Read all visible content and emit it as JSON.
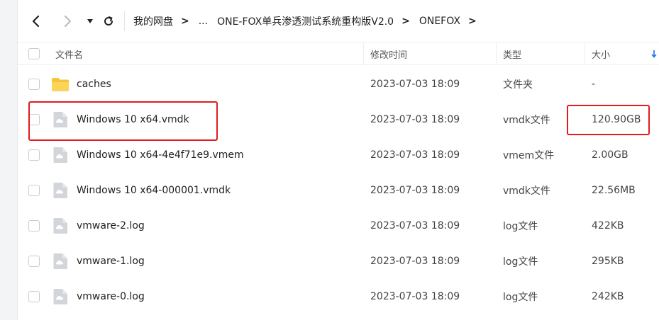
{
  "toolbar": {
    "breadcrumb": [
      "我的网盘",
      "...",
      "ONE-FOX单兵渗透测试系统重构版V2.0",
      "ONEFOX"
    ],
    "separator": ">"
  },
  "table": {
    "headers": {
      "name": "文件名",
      "modified": "修改时间",
      "type": "类型",
      "size": "大小"
    },
    "rows": [
      {
        "name": "caches",
        "modified": "2023-07-03 18:09",
        "type": "文件夹",
        "size": "-",
        "icon": "folder-icon"
      },
      {
        "name": "Windows 10 x64.vmdk",
        "modified": "2023-07-03 18:09",
        "type": "vmdk文件",
        "size": "120.90GB",
        "icon": "file-icon"
      },
      {
        "name": "Windows 10 x64-4e4f71e9.vmem",
        "modified": "2023-07-03 18:09",
        "type": "vmem文件",
        "size": "2.00GB",
        "icon": "file-icon"
      },
      {
        "name": "Windows 10 x64-000001.vmdk",
        "modified": "2023-07-03 18:09",
        "type": "vmdk文件",
        "size": "22.56MB",
        "icon": "file-icon"
      },
      {
        "name": "vmware-2.log",
        "modified": "2023-07-03 18:09",
        "type": "log文件",
        "size": "422KB",
        "icon": "file-icon"
      },
      {
        "name": "vmware-1.log",
        "modified": "2023-07-03 18:09",
        "type": "log文件",
        "size": "295KB",
        "icon": "file-icon"
      },
      {
        "name": "vmware-0.log",
        "modified": "2023-07-03 18:09",
        "type": "log文件",
        "size": "242KB",
        "icon": "file-icon"
      }
    ]
  },
  "colors": {
    "highlight": "#e21b1b",
    "folder": "#f7c33b",
    "accent": "#1a73e8"
  }
}
